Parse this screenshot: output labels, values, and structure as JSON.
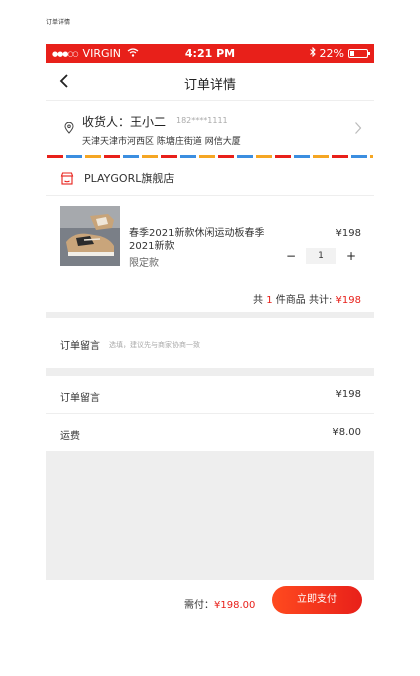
{
  "page_label": "订单详情",
  "status_bar": {
    "signal_dots": "●●●○○",
    "carrier": "VIRGIN",
    "time": "4:21 PM",
    "battery_percent": "22%",
    "battery_level": 0.22
  },
  "nav": {
    "title": "订单详情"
  },
  "address": {
    "recipient": "收货人：王小二",
    "phone": "182****1111",
    "line": "天津天津市河西区 陈塘庄街道 网信大厦"
  },
  "shop": {
    "name": "PLAYGORL旗舰店"
  },
  "product": {
    "title": "春季2021新款休闲运动板春季2021新款",
    "spec": "限定款",
    "price": "¥198",
    "minus": "−",
    "qty": "1",
    "plus": "+"
  },
  "summary": {
    "prefix": "共",
    "count": "1",
    "middle": "件商品 共计:",
    "total": "¥198"
  },
  "note": {
    "label": "订单留言",
    "placeholder": "选填，建议先与商家协商一致"
  },
  "lines": [
    {
      "label": "订单留言",
      "value": "¥198"
    },
    {
      "label": "运费",
      "value": "¥8.00"
    }
  ],
  "footer": {
    "due_label": "需付：",
    "due_value": "¥198.00",
    "pay_button": "立即支付"
  },
  "colors": {
    "accent": "#e8201a",
    "stripe_blue": "#3b8ee0",
    "stripe_orange": "#f5a623"
  }
}
